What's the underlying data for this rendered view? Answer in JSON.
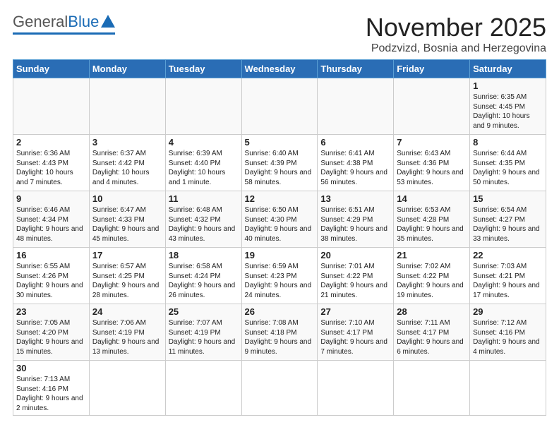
{
  "header": {
    "logo_general": "General",
    "logo_blue": "Blue",
    "month_title": "November 2025",
    "location": "Podzvizd, Bosnia and Herzegovina"
  },
  "weekdays": [
    "Sunday",
    "Monday",
    "Tuesday",
    "Wednesday",
    "Thursday",
    "Friday",
    "Saturday"
  ],
  "weeks": [
    [
      {
        "day": "",
        "info": ""
      },
      {
        "day": "",
        "info": ""
      },
      {
        "day": "",
        "info": ""
      },
      {
        "day": "",
        "info": ""
      },
      {
        "day": "",
        "info": ""
      },
      {
        "day": "",
        "info": ""
      },
      {
        "day": "1",
        "info": "Sunrise: 6:35 AM\nSunset: 4:45 PM\nDaylight: 10 hours\nand 9 minutes."
      }
    ],
    [
      {
        "day": "2",
        "info": "Sunrise: 6:36 AM\nSunset: 4:43 PM\nDaylight: 10 hours\nand 7 minutes."
      },
      {
        "day": "3",
        "info": "Sunrise: 6:37 AM\nSunset: 4:42 PM\nDaylight: 10 hours\nand 4 minutes."
      },
      {
        "day": "4",
        "info": "Sunrise: 6:39 AM\nSunset: 4:40 PM\nDaylight: 10 hours\nand 1 minute."
      },
      {
        "day": "5",
        "info": "Sunrise: 6:40 AM\nSunset: 4:39 PM\nDaylight: 9 hours\nand 58 minutes."
      },
      {
        "day": "6",
        "info": "Sunrise: 6:41 AM\nSunset: 4:38 PM\nDaylight: 9 hours\nand 56 minutes."
      },
      {
        "day": "7",
        "info": "Sunrise: 6:43 AM\nSunset: 4:36 PM\nDaylight: 9 hours\nand 53 minutes."
      },
      {
        "day": "8",
        "info": "Sunrise: 6:44 AM\nSunset: 4:35 PM\nDaylight: 9 hours\nand 50 minutes."
      }
    ],
    [
      {
        "day": "9",
        "info": "Sunrise: 6:46 AM\nSunset: 4:34 PM\nDaylight: 9 hours\nand 48 minutes."
      },
      {
        "day": "10",
        "info": "Sunrise: 6:47 AM\nSunset: 4:33 PM\nDaylight: 9 hours\nand 45 minutes."
      },
      {
        "day": "11",
        "info": "Sunrise: 6:48 AM\nSunset: 4:32 PM\nDaylight: 9 hours\nand 43 minutes."
      },
      {
        "day": "12",
        "info": "Sunrise: 6:50 AM\nSunset: 4:30 PM\nDaylight: 9 hours\nand 40 minutes."
      },
      {
        "day": "13",
        "info": "Sunrise: 6:51 AM\nSunset: 4:29 PM\nDaylight: 9 hours\nand 38 minutes."
      },
      {
        "day": "14",
        "info": "Sunrise: 6:53 AM\nSunset: 4:28 PM\nDaylight: 9 hours\nand 35 minutes."
      },
      {
        "day": "15",
        "info": "Sunrise: 6:54 AM\nSunset: 4:27 PM\nDaylight: 9 hours\nand 33 minutes."
      }
    ],
    [
      {
        "day": "16",
        "info": "Sunrise: 6:55 AM\nSunset: 4:26 PM\nDaylight: 9 hours\nand 30 minutes."
      },
      {
        "day": "17",
        "info": "Sunrise: 6:57 AM\nSunset: 4:25 PM\nDaylight: 9 hours\nand 28 minutes."
      },
      {
        "day": "18",
        "info": "Sunrise: 6:58 AM\nSunset: 4:24 PM\nDaylight: 9 hours\nand 26 minutes."
      },
      {
        "day": "19",
        "info": "Sunrise: 6:59 AM\nSunset: 4:23 PM\nDaylight: 9 hours\nand 24 minutes."
      },
      {
        "day": "20",
        "info": "Sunrise: 7:01 AM\nSunset: 4:22 PM\nDaylight: 9 hours\nand 21 minutes."
      },
      {
        "day": "21",
        "info": "Sunrise: 7:02 AM\nSunset: 4:22 PM\nDaylight: 9 hours\nand 19 minutes."
      },
      {
        "day": "22",
        "info": "Sunrise: 7:03 AM\nSunset: 4:21 PM\nDaylight: 9 hours\nand 17 minutes."
      }
    ],
    [
      {
        "day": "23",
        "info": "Sunrise: 7:05 AM\nSunset: 4:20 PM\nDaylight: 9 hours\nand 15 minutes."
      },
      {
        "day": "24",
        "info": "Sunrise: 7:06 AM\nSunset: 4:19 PM\nDaylight: 9 hours\nand 13 minutes."
      },
      {
        "day": "25",
        "info": "Sunrise: 7:07 AM\nSunset: 4:19 PM\nDaylight: 9 hours\nand 11 minutes."
      },
      {
        "day": "26",
        "info": "Sunrise: 7:08 AM\nSunset: 4:18 PM\nDaylight: 9 hours\nand 9 minutes."
      },
      {
        "day": "27",
        "info": "Sunrise: 7:10 AM\nSunset: 4:17 PM\nDaylight: 9 hours\nand 7 minutes."
      },
      {
        "day": "28",
        "info": "Sunrise: 7:11 AM\nSunset: 4:17 PM\nDaylight: 9 hours\nand 6 minutes."
      },
      {
        "day": "29",
        "info": "Sunrise: 7:12 AM\nSunset: 4:16 PM\nDaylight: 9 hours\nand 4 minutes."
      }
    ],
    [
      {
        "day": "30",
        "info": "Sunrise: 7:13 AM\nSunset: 4:16 PM\nDaylight: 9 hours\nand 2 minutes."
      },
      {
        "day": "",
        "info": ""
      },
      {
        "day": "",
        "info": ""
      },
      {
        "day": "",
        "info": ""
      },
      {
        "day": "",
        "info": ""
      },
      {
        "day": "",
        "info": ""
      },
      {
        "day": "",
        "info": ""
      }
    ]
  ]
}
